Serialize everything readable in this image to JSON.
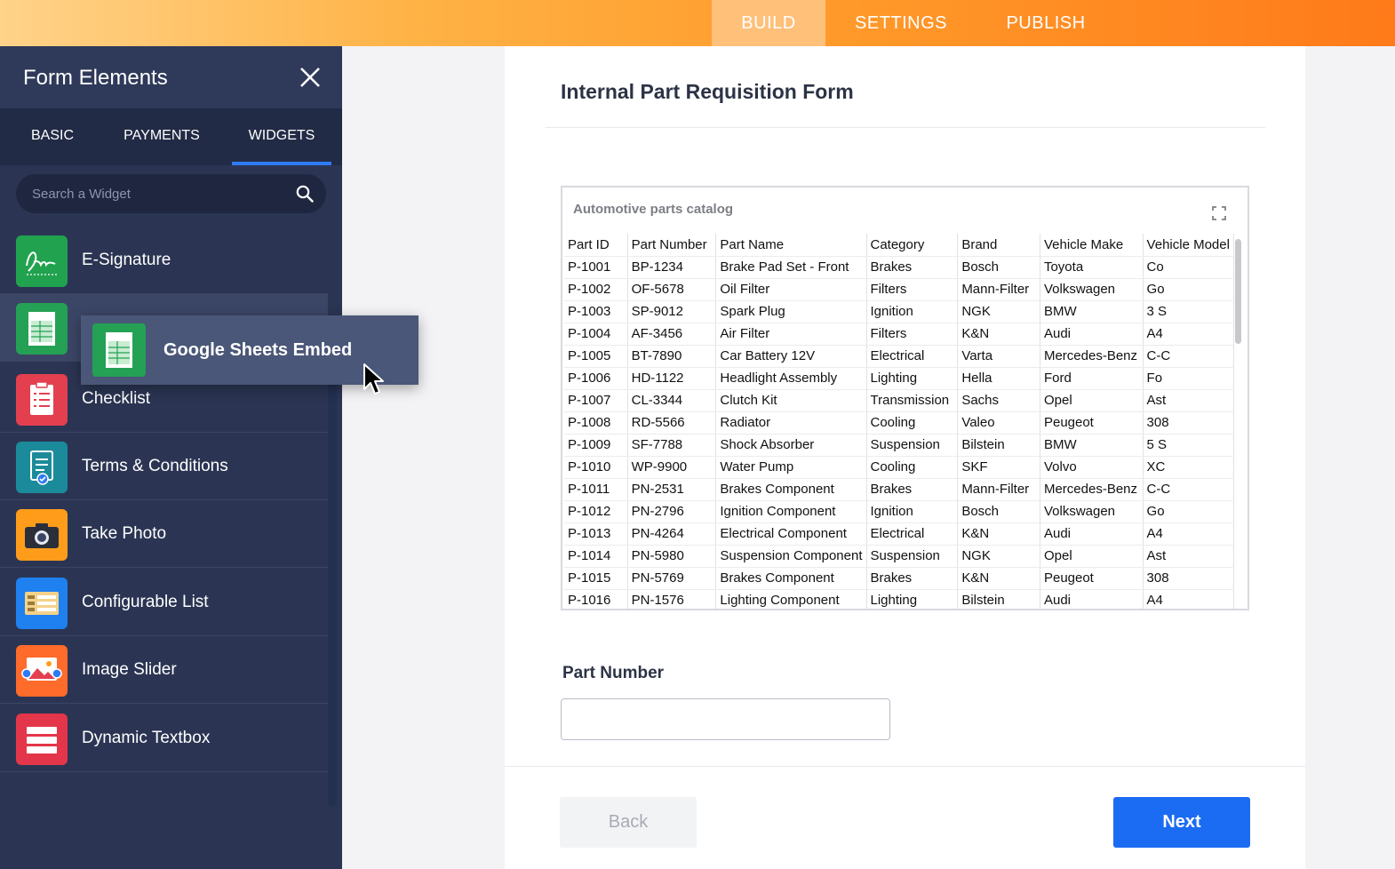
{
  "topbar": {
    "tabs": [
      {
        "label": "BUILD",
        "active": true
      },
      {
        "label": "SETTINGS",
        "active": false
      },
      {
        "label": "PUBLISH",
        "active": false
      }
    ]
  },
  "sidebar": {
    "title": "Form Elements",
    "tabs": [
      {
        "label": "BASIC",
        "active": false
      },
      {
        "label": "PAYMENTS",
        "active": false
      },
      {
        "label": "WIDGETS",
        "active": true
      }
    ],
    "search": {
      "placeholder": "Search a Widget",
      "value": ""
    },
    "widgets": [
      {
        "label": "E-Signature",
        "icon": "signature-icon",
        "color": "#21a24f"
      },
      {
        "label": "",
        "icon": "spreadsheet-icon",
        "color": "#24a154"
      },
      {
        "label": "Checklist",
        "icon": "checklist-icon",
        "color": "#e43f4f"
      },
      {
        "label": "Terms & Conditions",
        "icon": "document-check-icon",
        "color": "#1b8b9b"
      },
      {
        "label": "Take Photo",
        "icon": "camera-icon",
        "color": "#ff9d1b"
      },
      {
        "label": "Configurable List",
        "icon": "list-grid-icon",
        "color": "#1f80f0"
      },
      {
        "label": "Image Slider",
        "icon": "image-slider-icon",
        "color": "#ff6b2b"
      },
      {
        "label": "Dynamic Textbox",
        "icon": "textbox-icon",
        "color": "#e4364a"
      }
    ],
    "drag_item": {
      "label": "Google Sheets Embed",
      "icon": "spreadsheet-icon"
    }
  },
  "form": {
    "title": "Internal Part Requisition Form",
    "sheet": {
      "title": "Automotive parts catalog",
      "columns": [
        "Part ID",
        "Part Number",
        "Part Name",
        "Category",
        "Brand",
        "Vehicle Make",
        "Vehicle Model"
      ],
      "rows": [
        [
          "P-1001",
          "BP-1234",
          "Brake Pad Set - Front",
          "Brakes",
          "Bosch",
          "Toyota",
          "Co"
        ],
        [
          "P-1002",
          "OF-5678",
          "Oil Filter",
          "Filters",
          "Mann-Filter",
          "Volkswagen",
          "Go"
        ],
        [
          "P-1003",
          "SP-9012",
          "Spark Plug",
          "Ignition",
          "NGK",
          "BMW",
          "3 S"
        ],
        [
          "P-1004",
          "AF-3456",
          "Air Filter",
          "Filters",
          "K&N",
          "Audi",
          "A4"
        ],
        [
          "P-1005",
          "BT-7890",
          "Car Battery 12V",
          "Electrical",
          "Varta",
          "Mercedes-Benz",
          "C-C"
        ],
        [
          "P-1006",
          "HD-1122",
          "Headlight Assembly",
          "Lighting",
          "Hella",
          "Ford",
          "Fo"
        ],
        [
          "P-1007",
          "CL-3344",
          "Clutch Kit",
          "Transmission",
          "Sachs",
          "Opel",
          "Ast"
        ],
        [
          "P-1008",
          "RD-5566",
          "Radiator",
          "Cooling",
          "Valeo",
          "Peugeot",
          "308"
        ],
        [
          "P-1009",
          "SF-7788",
          "Shock Absorber",
          "Suspension",
          "Bilstein",
          "BMW",
          "5 S"
        ],
        [
          "P-1010",
          "WP-9900",
          "Water Pump",
          "Cooling",
          "SKF",
          "Volvo",
          "XC"
        ],
        [
          "P-1011",
          "PN-2531",
          "Brakes Component",
          "Brakes",
          "Mann-Filter",
          "Mercedes-Benz",
          "C-C"
        ],
        [
          "P-1012",
          "PN-2796",
          "Ignition Component",
          "Ignition",
          "Bosch",
          "Volkswagen",
          "Go"
        ],
        [
          "P-1013",
          "PN-4264",
          "Electrical Component",
          "Electrical",
          "K&N",
          "Audi",
          "A4"
        ],
        [
          "P-1014",
          "PN-5980",
          "Suspension Component",
          "Suspension",
          "NGK",
          "Opel",
          "Ast"
        ],
        [
          "P-1015",
          "PN-5769",
          "Brakes Component",
          "Brakes",
          "K&N",
          "Peugeot",
          "308"
        ],
        [
          "P-1016",
          "PN-1576",
          "Lighting Component",
          "Lighting",
          "Bilstein",
          "Audi",
          "A4"
        ]
      ]
    },
    "field": {
      "label": "Part Number",
      "value": "",
      "placeholder": ""
    },
    "buttons": {
      "back": "Back",
      "next": "Next"
    }
  },
  "colors": {
    "accent": "#1b6cf2",
    "topbar_orange": "#ff8f22",
    "sidebar_bg": "#2b3553"
  }
}
